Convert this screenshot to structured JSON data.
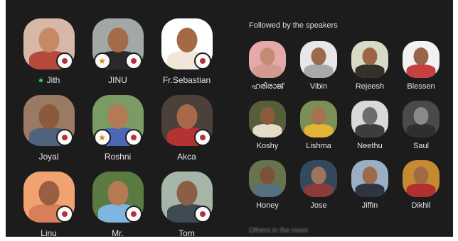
{
  "speakers": [
    {
      "name": "Jith",
      "live": true,
      "left_badge": false,
      "bg": "#d7b7a6",
      "skin": "#c58a64",
      "shirt": "#b64a3a"
    },
    {
      "name": "JINU",
      "live": false,
      "left_badge": true,
      "bg": "#a2a8a5",
      "skin": "#a36b49",
      "shirt": "#2a2a2a"
    },
    {
      "name": "Fr.Sebastian",
      "live": false,
      "left_badge": false,
      "bg": "#ffffff",
      "skin": "#a46a46",
      "shirt": "#f1e7d8"
    },
    {
      "name": "Joyal",
      "live": false,
      "left_badge": false,
      "bg": "#9a7a63",
      "skin": "#8b5a3c",
      "shirt": "#50627d"
    },
    {
      "name": "Roshni",
      "live": false,
      "left_badge": true,
      "bg": "#7a9b63",
      "skin": "#b37b55",
      "shirt": "#4b67b8"
    },
    {
      "name": "Akca",
      "live": false,
      "left_badge": false,
      "bg": "#4c403a",
      "skin": "#a7694a",
      "shirt": "#b33333"
    },
    {
      "name": "Linu",
      "live": false,
      "left_badge": false,
      "bg": "#f0a371",
      "skin": "#9a5f42",
      "shirt": "#d87f59"
    },
    {
      "name": "Mr.",
      "live": false,
      "left_badge": false,
      "bg": "#5b7a42",
      "skin": "#b47b52",
      "shirt": "#7fb6df"
    },
    {
      "name": "Tom",
      "live": false,
      "left_badge": false,
      "bg": "#a5b5a7",
      "skin": "#8c5e44",
      "shirt": "#3f4a52"
    }
  ],
  "followers_heading": "Followed by the speakers",
  "followers": [
    {
      "name": "ഹരിരാജ്",
      "bg": "#e4a9a9",
      "skin": "#c58c74",
      "shirt": "#d39a8e"
    },
    {
      "name": "Vibin",
      "bg": "#e7e7e7",
      "skin": "#9b6a4a",
      "shirt": "#a9a9a9"
    },
    {
      "name": "Rejeesh",
      "bg": "#d7dbc6",
      "skin": "#9b6645",
      "shirt": "#34302c"
    },
    {
      "name": "Blessen",
      "bg": "#f2f2f2",
      "skin": "#996447",
      "shirt": "#c74040"
    },
    {
      "name": "Koshy",
      "bg": "#55603a",
      "skin": "#8c5b3c",
      "shirt": "#e3dcc8"
    },
    {
      "name": "Lishma",
      "bg": "#7b8f57",
      "skin": "#a57252",
      "shirt": "#e3b436"
    },
    {
      "name": "Neethu",
      "bg": "#d9d9d9",
      "skin": "#6d6d6d",
      "shirt": "#3d3d3d"
    },
    {
      "name": "Saul",
      "bg": "#4a4a4a",
      "skin": "#8a8a8a",
      "shirt": "#2f2f2f"
    },
    {
      "name": "Honey",
      "bg": "#66734d",
      "skin": "#7b5238",
      "shirt": "#57707e"
    },
    {
      "name": "Jose",
      "bg": "#334a5c",
      "skin": "#a0735b",
      "shirt": "#8c3b3b"
    },
    {
      "name": "Jiffin",
      "bg": "#9aaec4",
      "skin": "#9b6a4a",
      "shirt": "#2e3440"
    },
    {
      "name": "Dikhil",
      "bg": "#c58a33",
      "skin": "#a06a45",
      "shirt": "#b12f2f"
    }
  ],
  "next_heading": "Others in the room",
  "colors": {
    "live": "#2ecc71",
    "badge": "#fafafa",
    "background": "#1c1c1c",
    "left_badge": "#d58a00"
  },
  "icons": {
    "speaker_badge": "mic-avatar-badge-icon",
    "left_badge": "celebrate-icon"
  }
}
